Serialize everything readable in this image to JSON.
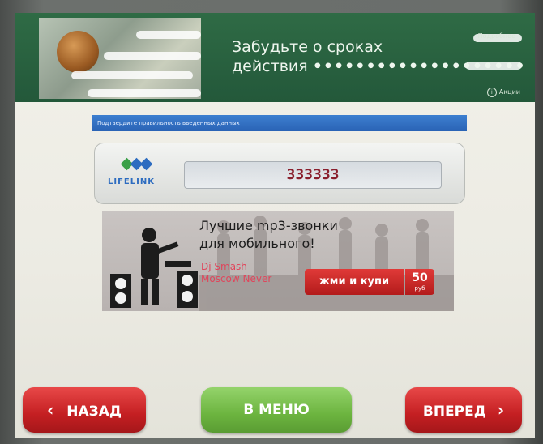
{
  "header": {
    "title_line1": "Забудьте о сроках",
    "title_line2": "действия",
    "title_dots": "••••••••••••••••••••",
    "corner_top": "Подробнее",
    "corner_bottom": "Акции"
  },
  "confirm_bar": {
    "text": "Подтвердите правильность введенных данных"
  },
  "operator": {
    "logo_text": "LIFELINK",
    "entered_value": "333333"
  },
  "banner": {
    "headline_line1": "Лучшие mp3-звонки",
    "headline_line2": "для мобильного!",
    "artist_line1": "Dj Smash –",
    "artist_line2": "Moscow Never",
    "buy_label": "жми и купи",
    "price_value": "50",
    "price_currency": "руб"
  },
  "nav": {
    "back_label": "НАЗАД",
    "menu_label": "В МЕНЮ",
    "next_label": "ВПЕРЕД"
  },
  "colors": {
    "header_green": "#2a6340",
    "confirm_blue": "#2f6cc0",
    "value_red": "#8a1f2d",
    "nav_red": "#c41f22",
    "nav_green": "#6cb43f"
  }
}
